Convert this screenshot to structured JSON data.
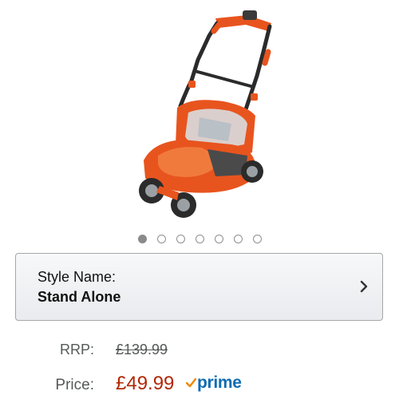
{
  "product": {
    "image_icon": "lawn-mower-image",
    "carousel": {
      "total": 7,
      "active_index": 0
    }
  },
  "style": {
    "label": "Style Name:",
    "value": "Stand Alone",
    "chevron_icon": "chevron-right-icon"
  },
  "pricing": {
    "rrp_label": "RRP:",
    "rrp_value": "£139.99",
    "price_label": "Price:",
    "price_value": "£49.99",
    "prime_text": "prime",
    "prime_icon": "prime-check-icon"
  },
  "colors": {
    "price": "#b12704",
    "prime": "#0f6cb1",
    "mower_orange": "#e8541e"
  }
}
